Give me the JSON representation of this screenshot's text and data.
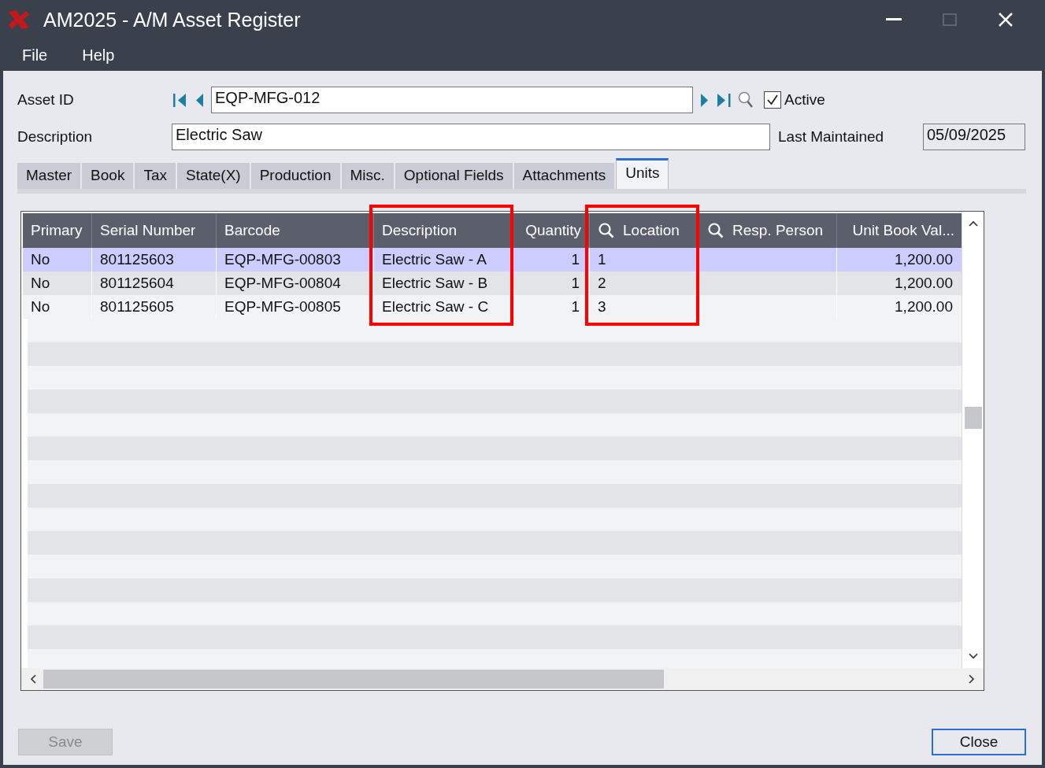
{
  "window": {
    "title": "AM2025 - A/M Asset Register"
  },
  "menu": [
    "File",
    "Help"
  ],
  "asset_id": {
    "label": "Asset ID",
    "value": "EQP-MFG-012"
  },
  "active": {
    "label": "Active",
    "checked": true
  },
  "description": {
    "label": "Description",
    "value": "Electric Saw"
  },
  "last_maintained": {
    "label": "Last Maintained",
    "value": "05/09/2025"
  },
  "tabs": [
    {
      "label": "Master",
      "selected": false
    },
    {
      "label": "Book",
      "selected": false
    },
    {
      "label": "Tax",
      "selected": false
    },
    {
      "label": "State(X)",
      "selected": false
    },
    {
      "label": "Production",
      "selected": false
    },
    {
      "label": "Misc.",
      "selected": false
    },
    {
      "label": "Optional Fields",
      "selected": false
    },
    {
      "label": "Attachments",
      "selected": false
    },
    {
      "label": "Units",
      "selected": true
    }
  ],
  "table": {
    "columns": [
      {
        "label": "Primary",
        "search": false,
        "highlighted": false
      },
      {
        "label": "Serial Number",
        "search": false,
        "highlighted": false
      },
      {
        "label": "Barcode",
        "search": false,
        "highlighted": false
      },
      {
        "label": "Description",
        "search": false,
        "highlighted": true
      },
      {
        "label": "Quantity",
        "search": false,
        "highlighted": false
      },
      {
        "label": "Location",
        "search": true,
        "highlighted": true
      },
      {
        "label": "Resp. Person",
        "search": true,
        "highlighted": false
      },
      {
        "label": "Unit Book Val...",
        "search": false,
        "highlighted": false
      }
    ],
    "rows": [
      {
        "selected": true,
        "cells": [
          "No",
          "801125603",
          "EQP-MFG-00803",
          "Electric Saw - A",
          "1",
          "1",
          "",
          "1,200.00"
        ]
      },
      {
        "selected": false,
        "cells": [
          "No",
          "801125604",
          "EQP-MFG-00804",
          "Electric Saw - B",
          "1",
          "2",
          "",
          "1,200.00"
        ]
      },
      {
        "selected": false,
        "cells": [
          "No",
          "801125605",
          "EQP-MFG-00805",
          "Electric Saw - C",
          "1",
          "3",
          "",
          "1,200.00"
        ]
      }
    ]
  },
  "buttons": [
    {
      "label": "Save",
      "disabled": true
    },
    {
      "label": "Close",
      "disabled": false
    }
  ]
}
